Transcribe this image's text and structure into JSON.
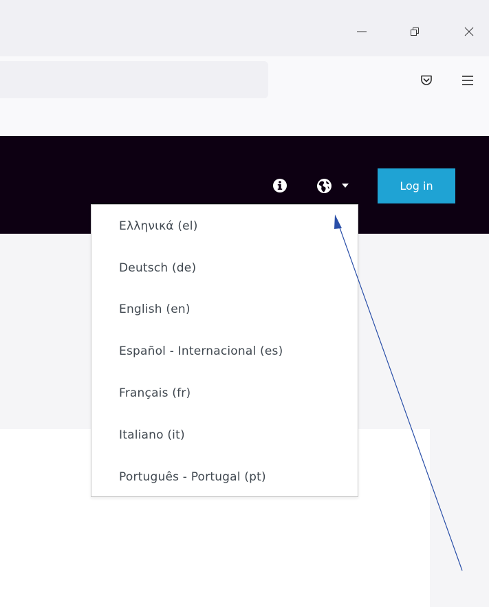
{
  "navbar": {
    "login_label": "Log in"
  },
  "language_menu": {
    "items": [
      "Ελληνικά (el)",
      "Deutsch (de)",
      "English (en)",
      "Español - Internacional (es)",
      "Français (fr)",
      "Italiano (it)",
      "Português - Portugal (pt)"
    ]
  },
  "icons": {
    "minimize": "minimize-icon",
    "restore": "restore-icon",
    "close": "close-icon",
    "pocket": "pocket-icon",
    "menu": "hamburger-menu-icon",
    "info": "info-icon",
    "language": "globe-icon",
    "caret": "caret-down-icon"
  },
  "colors": {
    "navbar_bg": "#0d0012",
    "login_button_bg": "#1fa3d4",
    "annotation_arrow": "#2a4fa8"
  }
}
